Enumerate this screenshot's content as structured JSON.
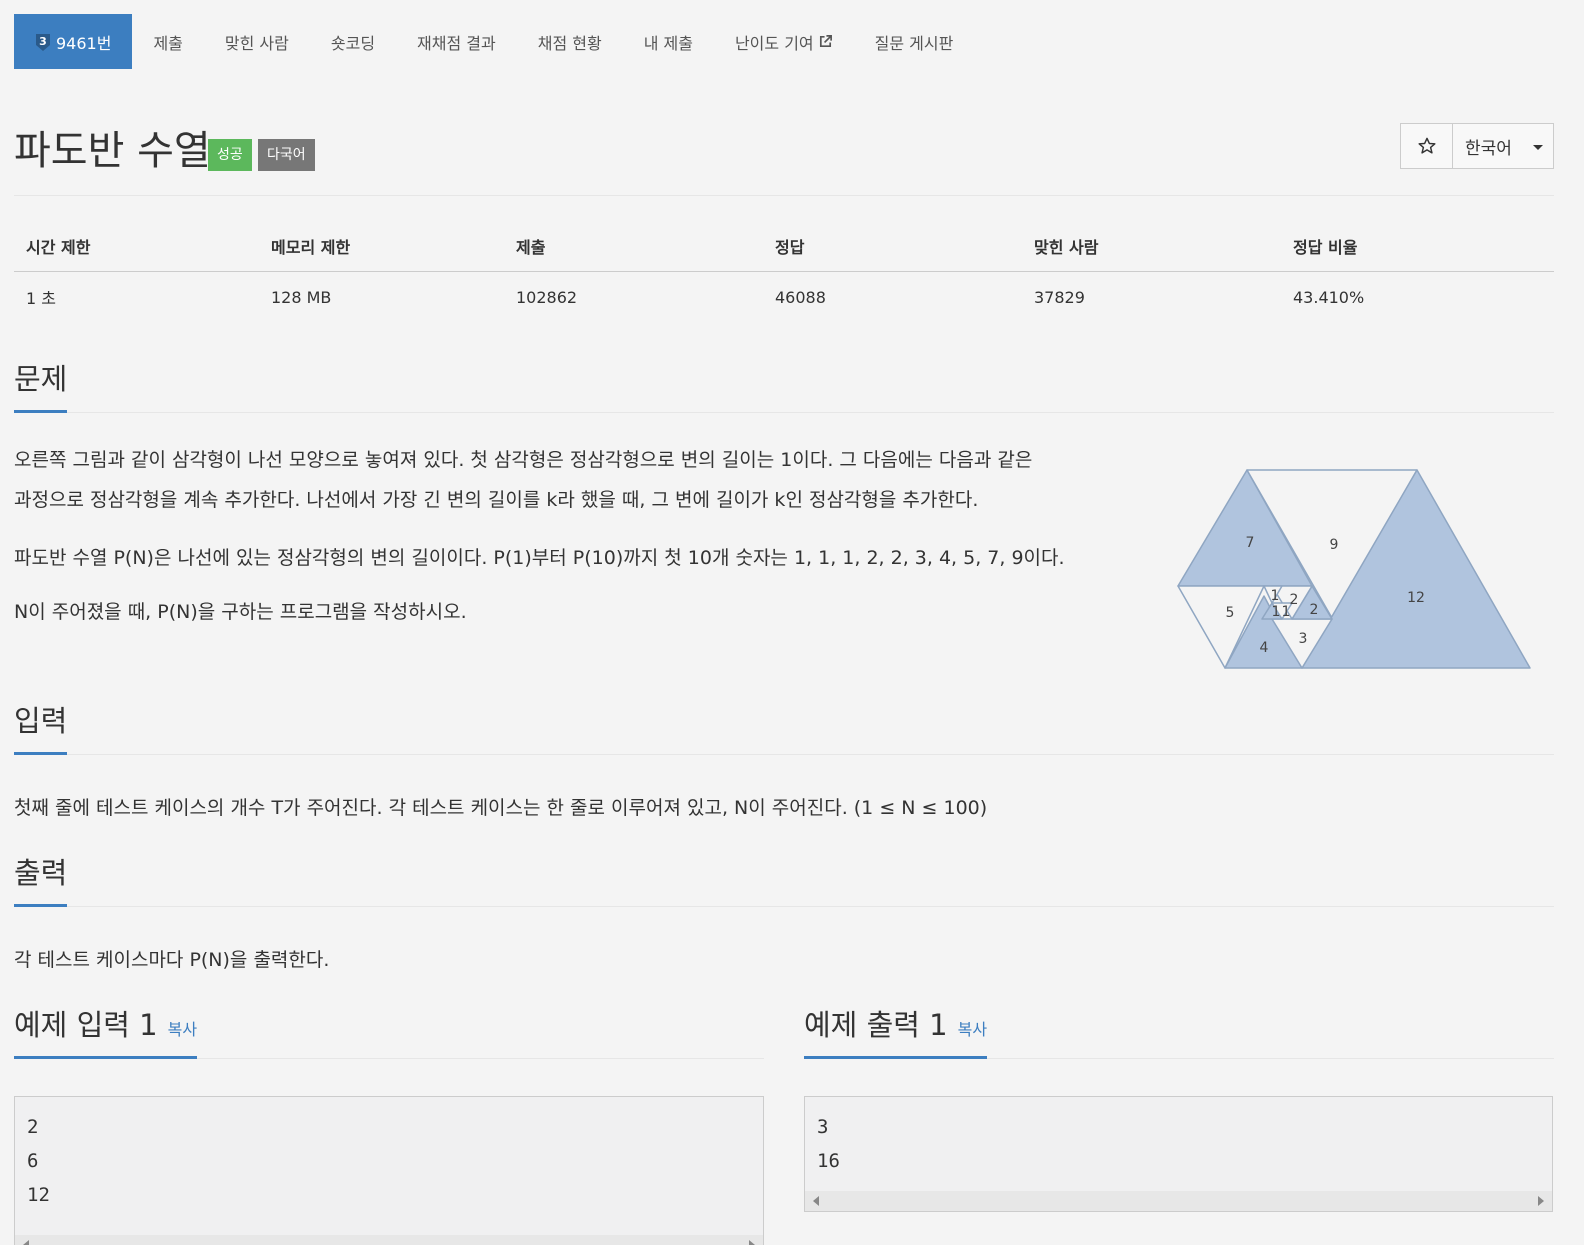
{
  "nav": {
    "tier_number": "3",
    "problem_tab": "9461번",
    "items": [
      "제출",
      "맞힌 사람",
      "숏코딩",
      "재채점 결과",
      "채점 현황",
      "내 제출",
      "난이도 기여",
      "질문 게시판"
    ]
  },
  "title": "파도반 수열",
  "badges": {
    "success": "성공",
    "lang": "다국어"
  },
  "lang_button": "한국어",
  "info": {
    "headers": [
      "시간 제한",
      "메모리 제한",
      "제출",
      "정답",
      "맞힌 사람",
      "정답 비율"
    ],
    "values": [
      "1 초",
      "128 MB",
      "102862",
      "46088",
      "37829",
      "43.410%"
    ]
  },
  "sections": {
    "problem": "문제",
    "input": "입력",
    "output": "출력",
    "sample_input": "예제 입력 1",
    "sample_output": "예제 출력 1",
    "copy": "복사"
  },
  "problem": {
    "p1_line1": "오른쪽 그림과 같이 삼각형이 나선 모양으로 놓여져 있다. 첫 삼각형은 정삼각형으로 변의 길이는 1이다. 그 다음에는 다음과 같은",
    "p1_line2": "과정으로 정삼각형을 계속 추가한다. 나선에서 가장 긴 변의 길이를 k라 했을 때, 그 변에 길이가 k인 정삼각형을 추가한다.",
    "p2": "파도반 수열 P(N)은 나선에 있는 정삼각형의 변의 길이이다. P(1)부터 P(10)까지 첫 10개 숫자는 1, 1, 1, 2, 2, 3, 4, 5, 7, 9이다.",
    "p3": "N이 주어졌을 때, P(N)을 구하는 프로그램을 작성하시오."
  },
  "figure_labels": [
    "7",
    "9",
    "12",
    "5",
    "1",
    "2",
    "1",
    "1",
    "2",
    "3",
    "4"
  ],
  "input_text": "첫째 줄에 테스트 케이스의 개수 T가 주어진다. 각 테스트 케이스는 한 줄로 이루어져 있고, N이 주어진다. (1 ≤ N ≤ 100)",
  "output_text": "각 테스트 케이스마다 P(N)을 출력한다.",
  "sample_input": "2\n6\n12",
  "sample_output": "3\n16"
}
